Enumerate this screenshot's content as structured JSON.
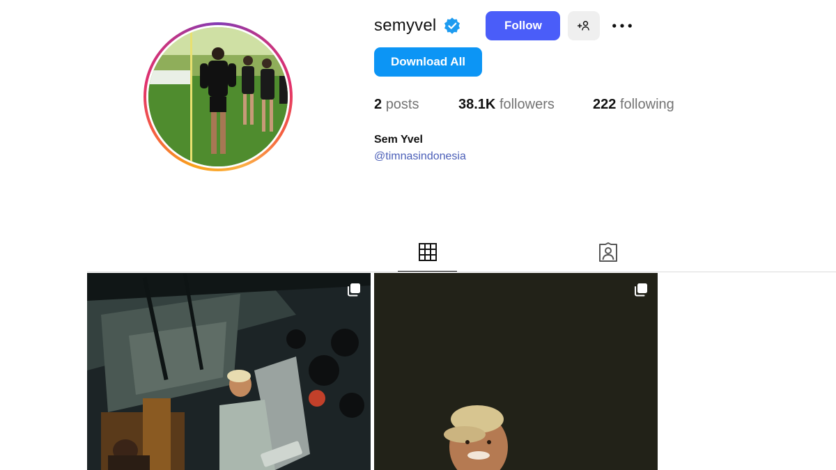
{
  "profile": {
    "username": "semyvel",
    "verified": true,
    "follow_label": "Follow",
    "download_label": "Download All",
    "stats": {
      "posts_count": "2",
      "posts_label": "posts",
      "followers_count": "38.1K",
      "followers_label": "followers",
      "following_count": "222",
      "following_label": "following"
    },
    "full_name": "Sem Yvel",
    "bio_link": "@timnasindonesia"
  },
  "icons": {
    "verified": "verified-badge-icon",
    "suggest": "add-person-icon",
    "more": "more-options-icon",
    "posts_tab": "grid-icon",
    "tagged_tab": "tagged-person-icon",
    "carousel": "multiple-photos-icon"
  },
  "tabs": [
    {
      "name": "posts",
      "active": true
    },
    {
      "name": "tagged",
      "active": false
    }
  ],
  "posts": [
    {
      "type": "carousel"
    },
    {
      "type": "carousel"
    }
  ],
  "colors": {
    "follow_button": "#4a5df9",
    "download_button": "#0c95f5",
    "verified_badge": "#1d9bf0",
    "bio_link": "#4b5fb8",
    "stat_label": "#737373"
  }
}
